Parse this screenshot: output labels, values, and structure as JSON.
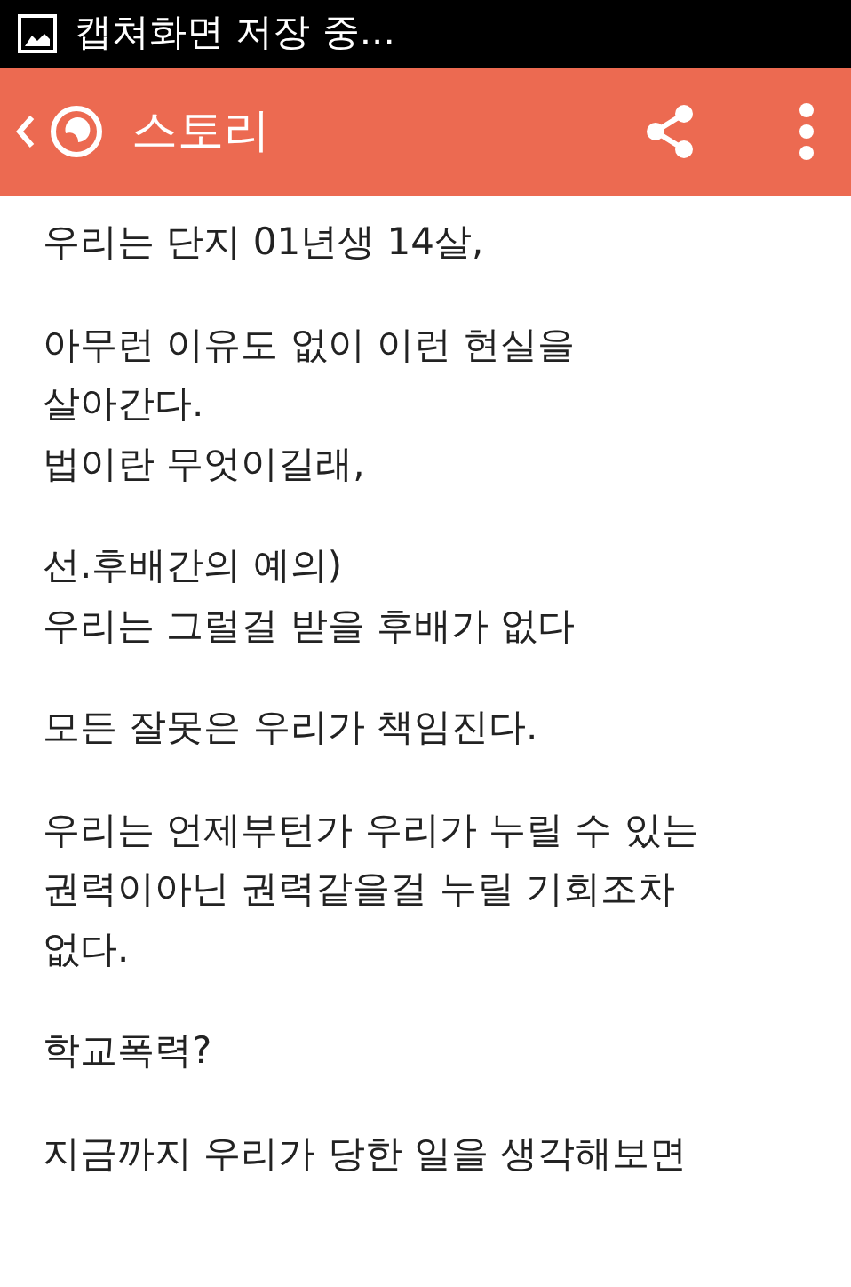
{
  "status_bar": {
    "notification": "캡쳐화면 저장 중..."
  },
  "app_bar": {
    "title": "스토리"
  },
  "story": {
    "paragraphs": [
      {
        "lines": [
          "우리는 단지 01년생 14살,"
        ]
      },
      {
        "lines": [
          "아무런  이유도 없이 이런 현실을",
          "살아간다.",
          "법이란 무엇이길래,"
        ]
      },
      {
        "lines": [
          "선.후배간의 예의)",
          "우리는 그럴걸 받을 후배가 없다"
        ]
      },
      {
        "lines": [
          "모든 잘못은 우리가 책임진다."
        ]
      },
      {
        "lines": [
          "우리는 언제부턴가 우리가 누릴 수 있는",
          "권력이아닌 권력같을걸 누릴 기회조차",
          "없다."
        ]
      },
      {
        "lines": [
          "학교폭력?"
        ]
      },
      {
        "lines": [
          "지금까지 우리가 당한 일을 생각해보면"
        ]
      }
    ]
  }
}
